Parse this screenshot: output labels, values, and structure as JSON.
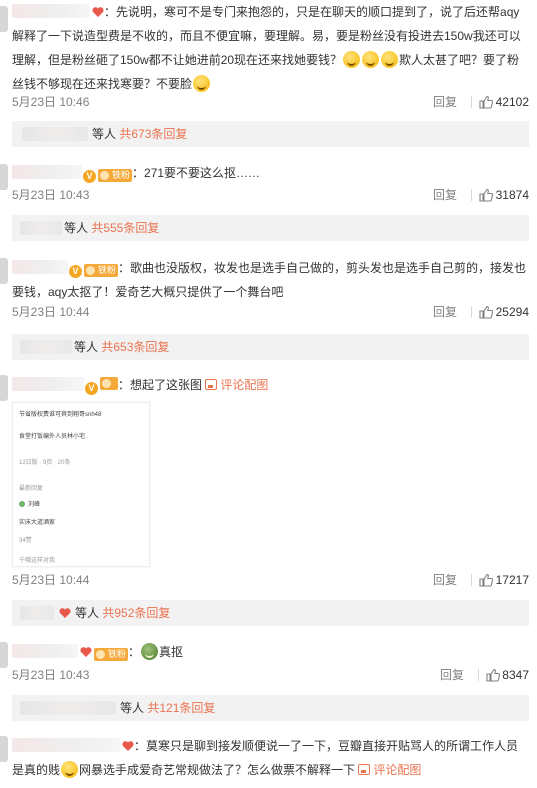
{
  "comments": [
    {
      "text_parts": [
        "先说明，寒可不是专门来抱怨的，只是在聊天的顺口提到了，说了后还帮aqy解释了一下说造型费是不收的，而且不便宜嘛，要理解。易，要是粉丝没有投进去150w我还可以理解，但是粉丝砸了150w都不让她进前20现在还来找她要钱？",
        "欺人太甚了吧？要了粉丝钱不够现在还来找寒要？不要脸"
      ],
      "time": "5月23日 10:46",
      "reply_label": "回复",
      "likes": "42102",
      "sub_count": "共673条回复",
      "sub_suffix": "等人"
    },
    {
      "fan_badge": "铁粉",
      "text": "271要不要这么抠……",
      "time": "5月23日 10:43",
      "reply_label": "回复",
      "likes": "31874",
      "sub_count": "共555条回复",
      "sub_suffix": "等人"
    },
    {
      "fan_badge": "铁粉",
      "text": "歌曲也没版权，妆发也是选手自己做的，剪头发也是选手自己剪的，接发也要钱，aqy太抠了！爱奇艺大概只提供了一个舞台吧",
      "time": "5月23日 10:44",
      "reply_label": "回复",
      "likes": "25294",
      "sub_count": "共653条回复",
      "sub_suffix": "等人"
    },
    {
      "text": "想起了这张图",
      "link_label": "评论配图",
      "image_lines": [
        "节省版权费谁可爽到翔哥snh48",
        "食堂打饭编外人员林小宅",
        "12日版 · 9页 · 20条",
        "最新回复",
        "刘峰",
        "实床大道酒家",
        "34赞",
        "千哦这样对我"
      ],
      "time": "5月23日 10:44",
      "reply_label": "回复",
      "likes": "17217",
      "sub_count": "共952条回复",
      "sub_suffix": "等人"
    },
    {
      "fan_badge": "铁粉",
      "text": "真抠",
      "time": "5月23日 10:43",
      "reply_label": "回复",
      "likes": "8347",
      "sub_count": "共121条回复",
      "sub_suffix": "等人"
    },
    {
      "text_parts": [
        "莫寒只是聊到接发顺便说一了一下，豆瓣直接开贴骂人的所谓工作人员是真的贱",
        "网暴选手成爱奇艺常规做法了？怎么做票不解释一下"
      ],
      "link_label": "评论配图"
    }
  ],
  "colors": {
    "accent": "#eb7350",
    "badge": "#f4a93a",
    "meta": "#808080",
    "reply_bg": "#f2f2f2"
  },
  "icons": [
    "thumbs-up-icon",
    "vip-badge-icon",
    "heart-icon",
    "picture-icon",
    "emoji-icon"
  ]
}
